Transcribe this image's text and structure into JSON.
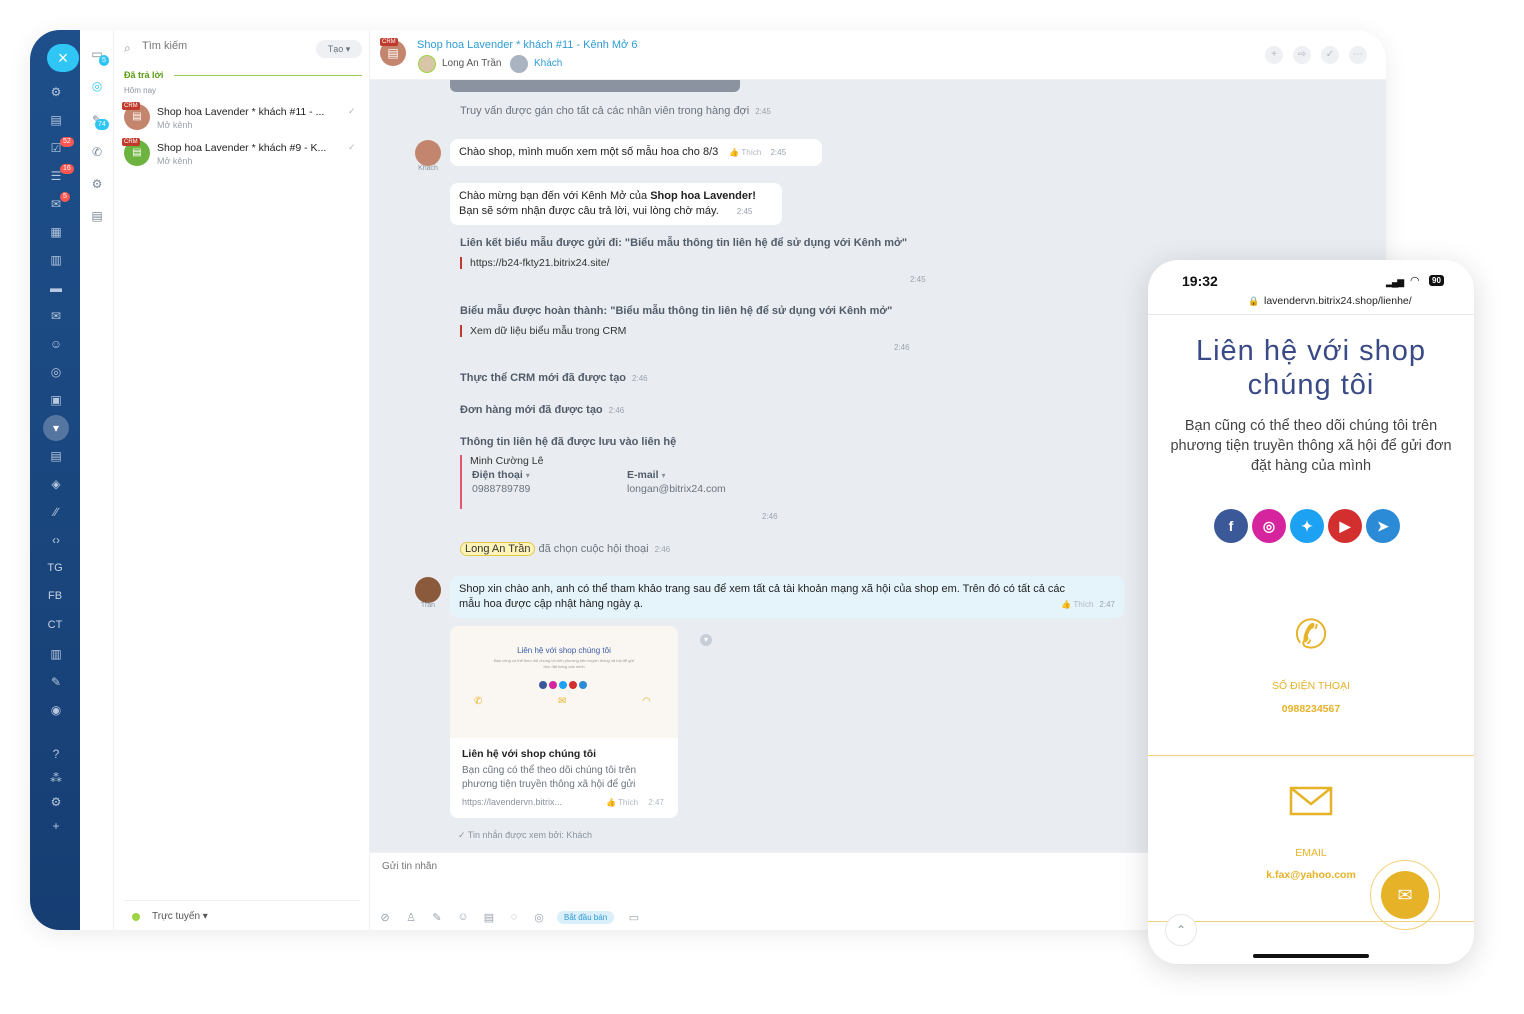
{
  "sidebar": {
    "close_label": "×",
    "badges": [
      "52",
      "16",
      "5"
    ],
    "text_items": [
      "TG",
      "FB",
      "CT"
    ]
  },
  "iconcol": {
    "badges": [
      "5",
      "74"
    ]
  },
  "chatlist": {
    "search_placeholder": "Tìm kiếm",
    "create_label": "Tạo",
    "section_label": "Đã trả lời",
    "today_label": "Hôm nay",
    "crm_tag": "CRM",
    "items": [
      {
        "title": "Shop hoa Lavender * khách #11 - ...",
        "subtitle": "Mở kênh",
        "color": "#c4856e"
      },
      {
        "title": "Shop hoa Lavender * khách #9 - K...",
        "subtitle": "Mở kênh",
        "color": "#6db33f"
      }
    ],
    "status": "Trực tuyến"
  },
  "chat": {
    "header": {
      "title": "Shop hoa Lavender * khách #11 - Kênh Mở 6",
      "user": "Long An Trần",
      "guest": "Khách"
    },
    "messages": {
      "m1": "Truy vấn được gán cho tất cả các nhân viên trong hàng đợi",
      "m1_time": "2:45",
      "guest_msg": "Chào shop, mình muốn xem một số mẫu hoa cho 8/3",
      "guest_like": "Thích",
      "guest_time": "2:45",
      "guest_name": "Khách",
      "welcome_line1_prefix": "Chào mừng bạn đến với Kênh Mở của ",
      "welcome_line1_bold": "Shop hoa Lavender!",
      "welcome_line2": "Bạn sẽ sớm nhận được câu trả lời, vui lòng chờ máy.",
      "welcome_time": "2:45",
      "form_sent": "Liên kết biểu mẫu được gửi đi: \"Biểu mẫu thông tin liên hệ để sử dụng với Kênh mở\"",
      "form_link": "https://b24-fkty21.bitrix24.site/",
      "form_time": "2:45",
      "form_done": "Biểu mẫu được hoàn thành: \"Biểu mẫu thông tin liên hệ để sử dụng với Kênh mở\"",
      "form_done_link": "Xem dữ liệu biểu mẫu trong CRM",
      "form_done_time": "2:46",
      "crm_created": "Thực thể CRM mới đã được tạo",
      "crm_created_time": "2:46",
      "order_created": "Đơn hàng mới đã được tạo",
      "order_time": "2:46",
      "contact_saved": "Thông tin liên hệ đã được lưu vào liên hệ",
      "contact_name": "Minh Cường Lê",
      "phone_label": "Điện thoại",
      "phone_value": "0988789789",
      "email_label": "E-mail",
      "email_value": "longan@bitrix24.com",
      "contact_time": "2:46",
      "picked_name": "Long An Trần",
      "picked_text": "đã chọn cuộc hội thoại",
      "picked_time": "2:46",
      "op_msg_line1": "Shop xin chào anh, anh có thể tham khảo trang sau để xem tất cả tài khoản mạng xã hội của shop em. Trên đó có tất cả các",
      "op_msg_line2": "mẫu hoa được cập nhật hàng ngày ạ.",
      "op_like": "Thích",
      "op_time": "2:47",
      "op_name": "Trần"
    },
    "preview": {
      "img_title": "Liên hệ với shop chúng tôi",
      "img_sub": "Bạn cũng có thể theo dõi chúng tôi trên phương tiện truyền thông xã hội để gửi đơn đặt hàng của mình",
      "title": "Liên hệ với shop chúng tôi",
      "desc": "Bạn cũng có thể theo dõi chúng tôi trên phương tiện truyền thông xã hội để gửi",
      "url": "https://lavendervn.bitrix...",
      "like": "Thích",
      "time": "2:47"
    },
    "read_note": "Tin nhắn được xem bởi: Khách",
    "input_placeholder": "Gửi tin nhắn",
    "start_sale": "Bắt đầu bán"
  },
  "phone": {
    "time": "19:32",
    "battery": "90",
    "url": "lavendervn.bitrix24.shop/lienhe/",
    "heading": "Liên hệ với shop chúng tôi",
    "desc": "Bạn cũng có thể theo dõi chúng tôi trên phương tiện truyền thông xã hội để gửi đơn đặt hàng của mình",
    "phone_label": "SỐ ĐIỆN THOẠI",
    "phone_value": "0988234567",
    "email_label": "EMAIL",
    "email_value": "k.fax@yahoo.com",
    "social_colors": [
      "#3b5998",
      "#d6249f",
      "#1da1f2",
      "#d32f2f",
      "#2b8bd6"
    ]
  },
  "colors": {
    "accent": "#2fc6f6",
    "brand_dark": "#1e4f8a",
    "gold": "#e6b227"
  }
}
